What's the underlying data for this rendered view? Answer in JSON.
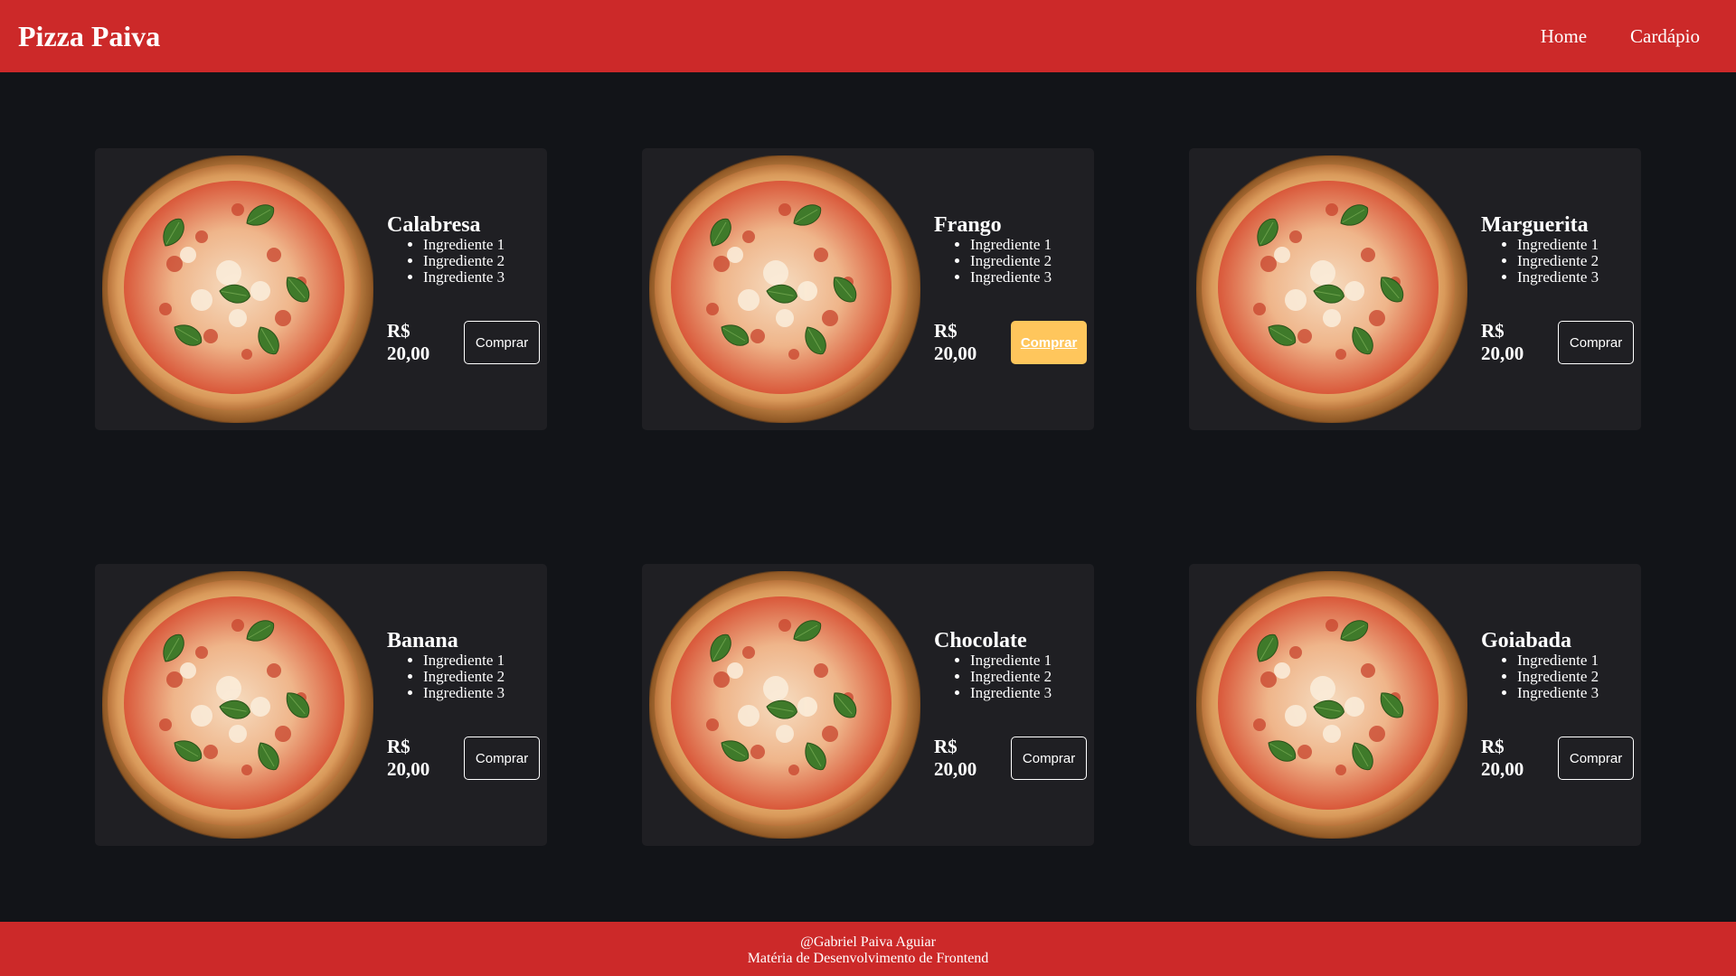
{
  "header": {
    "logo": "Pizza Paiva",
    "nav": [
      {
        "label": "Home"
      },
      {
        "label": "Cardápio"
      }
    ]
  },
  "colors": {
    "brand_red": "#cc2929",
    "page_bg": "#121418",
    "card_bg": "#1f1f23",
    "button_hover": "#ffc65c"
  },
  "products": [
    {
      "name": "Calabresa",
      "ingredients": [
        "Ingrediente 1",
        "Ingrediente 2",
        "Ingrediente 3"
      ],
      "price": "R$ 20,00",
      "button": "Comprar",
      "image_icon": "pizza-image"
    },
    {
      "name": "Frango",
      "ingredients": [
        "Ingrediente 1",
        "Ingrediente 2",
        "Ingrediente 3"
      ],
      "price": "R$ 20,00",
      "button": "Comprar",
      "image_icon": "pizza-image",
      "button_state": "hover"
    },
    {
      "name": "Marguerita",
      "ingredients": [
        "Ingrediente 1",
        "Ingrediente 2",
        "Ingrediente 3"
      ],
      "price": "R$ 20,00",
      "button": "Comprar",
      "image_icon": "pizza-image"
    },
    {
      "name": "Banana",
      "ingredients": [
        "Ingrediente 1",
        "Ingrediente 2",
        "Ingrediente 3"
      ],
      "price": "R$ 20,00",
      "button": "Comprar",
      "image_icon": "pizza-image"
    },
    {
      "name": "Chocolate",
      "ingredients": [
        "Ingrediente 1",
        "Ingrediente 2",
        "Ingrediente 3"
      ],
      "price": "R$ 20,00",
      "button": "Comprar",
      "image_icon": "pizza-image"
    },
    {
      "name": "Goiabada",
      "ingredients": [
        "Ingrediente 1",
        "Ingrediente 2",
        "Ingrediente 3"
      ],
      "price": "R$ 20,00",
      "button": "Comprar",
      "image_icon": "pizza-image"
    }
  ],
  "footer": {
    "line1": "@Gabriel Paiva Aguiar",
    "line2": "Matéria de Desenvolvimento de Frontend"
  }
}
